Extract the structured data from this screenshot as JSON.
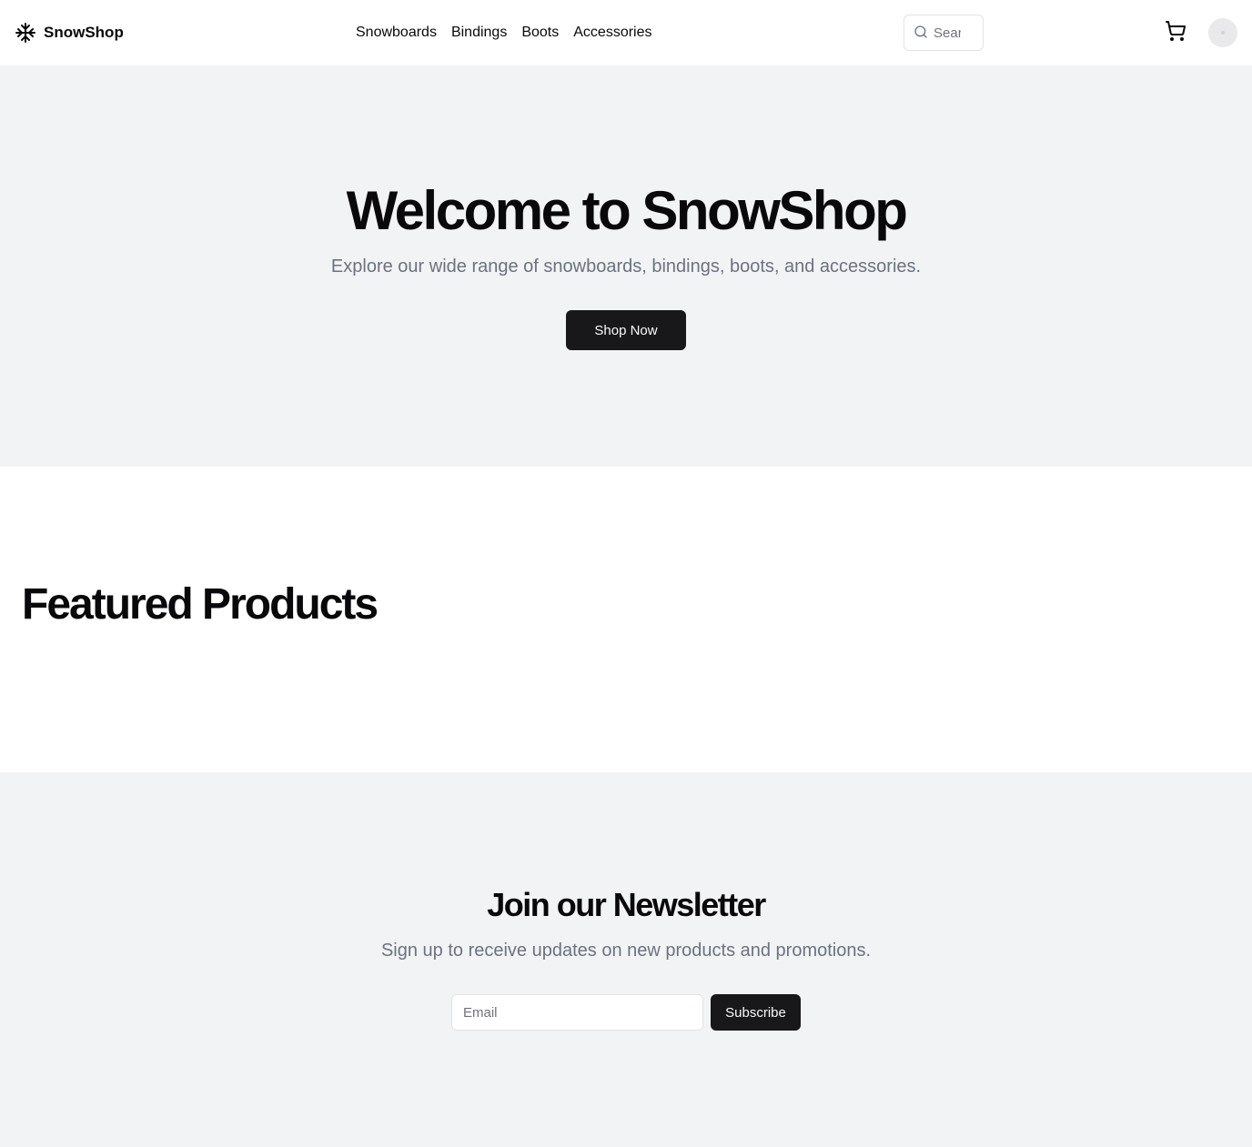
{
  "header": {
    "brand": "SnowShop",
    "nav": [
      "Snowboards",
      "Bindings",
      "Boots",
      "Accessories"
    ],
    "search_placeholder": "Search",
    "icons": {
      "logo": "snowflake-icon",
      "search": "search-icon",
      "cart": "shopping-cart-icon",
      "avatar": "avatar"
    }
  },
  "hero": {
    "title": "Welcome to SnowShop",
    "subtitle": "Explore our wide range of snowboards, bindings, boots, and accessories.",
    "cta_label": "Shop Now"
  },
  "featured": {
    "title": "Featured Products"
  },
  "newsletter": {
    "title": "Join our Newsletter",
    "subtitle": "Sign up to receive updates on new products and promotions.",
    "email_placeholder": "Email",
    "submit_label": "Subscribe"
  },
  "colors": {
    "page_background": "#ffffff",
    "section_background": "#f2f3f5",
    "primary_button": "#18181b",
    "muted_text": "#6b7280",
    "border": "#e4e4e7"
  }
}
